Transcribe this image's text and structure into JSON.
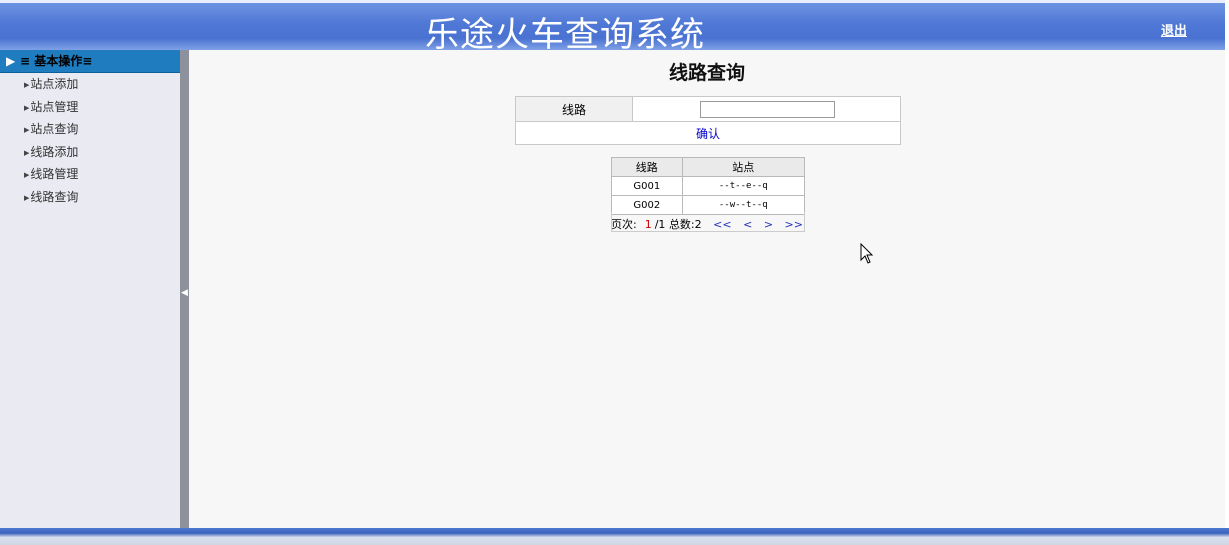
{
  "header": {
    "title": "乐途火车查询系统",
    "logout_label": "退出"
  },
  "sidebar": {
    "group_label": "≡ 基本操作≡",
    "items": [
      {
        "label": "站点添加"
      },
      {
        "label": "站点管理"
      },
      {
        "label": "站点查询"
      },
      {
        "label": "线路添加"
      },
      {
        "label": "线路管理"
      },
      {
        "label": "线路查询"
      }
    ]
  },
  "main": {
    "title": "线路查询",
    "form": {
      "route_label": "线路",
      "route_value": "",
      "confirm_label": "确认"
    },
    "table": {
      "headers": [
        "线路",
        "站点"
      ],
      "rows": [
        [
          "G001",
          "--t--e--q"
        ],
        [
          "G002",
          "--w--t--q"
        ]
      ]
    },
    "pager": {
      "page_label": "页次:",
      "current": "1",
      "total_pages": "/1",
      "total_label": "总数:",
      "total": "2",
      "first": "<<",
      "prev": "<",
      "next": ">",
      "last": ">>"
    }
  }
}
